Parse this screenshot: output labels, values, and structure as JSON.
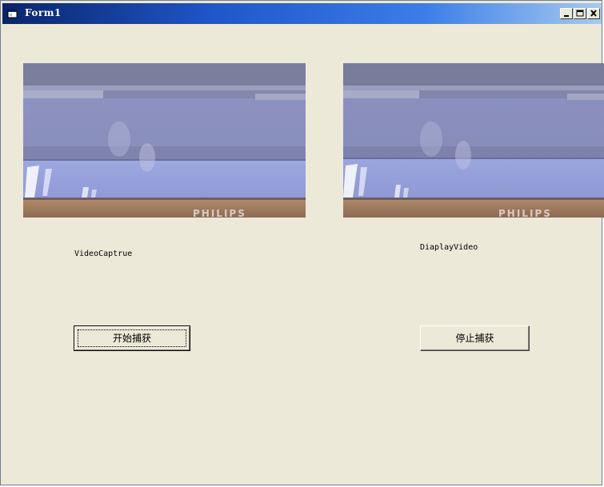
{
  "window": {
    "title": "Form1",
    "controls": {
      "minimize": "minimize-icon",
      "maximize": "maximize-icon",
      "close": "close-icon"
    }
  },
  "captions": {
    "capture": "VideoCaptrue",
    "display": "DiaplayVideo"
  },
  "video_overlay_text": "PHILIPS",
  "buttons": {
    "start_label": "开始捕获",
    "stop_label": "停止捕获"
  },
  "colors": {
    "form_background": "#ece9d8",
    "titlebar_start": "#0a246a",
    "titlebar_end": "#a6caf0"
  }
}
